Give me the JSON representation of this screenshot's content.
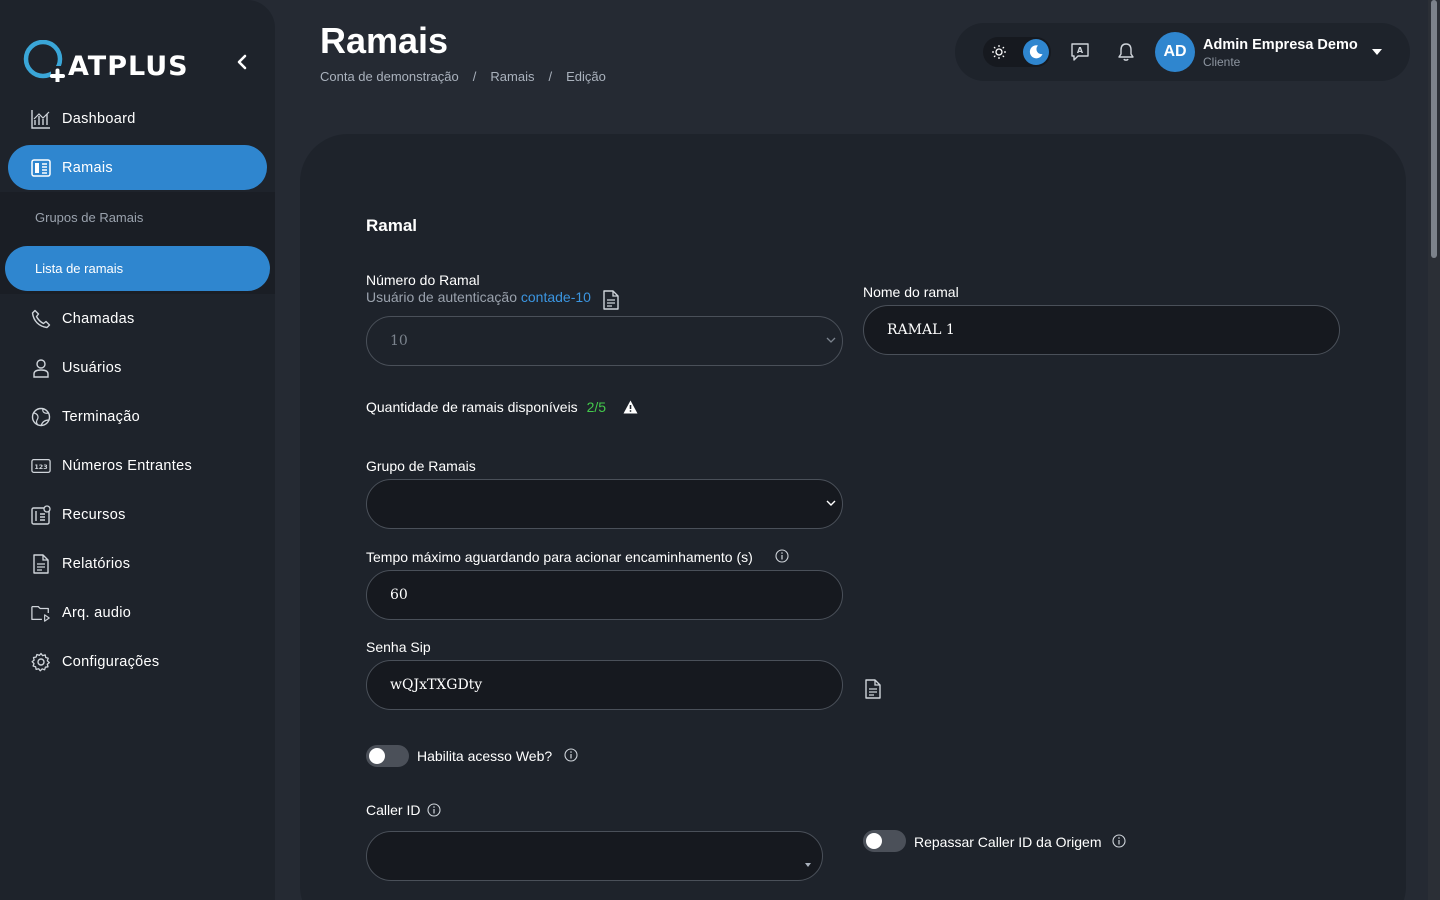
{
  "brand": {
    "logo_text": "ATPLUS"
  },
  "sidebar": {
    "items": [
      {
        "label": "Dashboard",
        "icon": "chart-icon"
      },
      {
        "label": "Ramais",
        "icon": "extension-icon",
        "active": true
      },
      {
        "label": "Chamadas",
        "icon": "phone-icon"
      },
      {
        "label": "Usuários",
        "icon": "user-icon"
      },
      {
        "label": "Terminação",
        "icon": "globe-icon"
      },
      {
        "label": "Números Entrantes",
        "icon": "numbers-icon"
      },
      {
        "label": "Recursos",
        "icon": "resources-icon"
      },
      {
        "label": "Relatórios",
        "icon": "report-icon"
      },
      {
        "label": "Arq. audio",
        "icon": "audio-folder-icon"
      },
      {
        "label": "Configurações",
        "icon": "gear-icon"
      }
    ],
    "subitems": [
      {
        "label": "Grupos de Ramais"
      },
      {
        "label": "Lista de ramais",
        "active": true
      }
    ]
  },
  "header": {
    "title": "Ramais",
    "breadcrumb": [
      "Conta de demonstração",
      "Ramais",
      "Edição"
    ],
    "user": {
      "initials": "AD",
      "name": "Admin Empresa Demo",
      "role": "Cliente"
    }
  },
  "form": {
    "section_title": "Ramal",
    "numero": {
      "label": "Número do Ramal",
      "auth_prefix": "Usuário de autenticação",
      "auth_user": "contade-10",
      "value": "10"
    },
    "nome": {
      "label": "Nome do ramal",
      "value": "RAMAL 1"
    },
    "quantidade": {
      "label": "Quantidade de ramais disponíveis",
      "value": "2/5"
    },
    "grupo": {
      "label": "Grupo de Ramais",
      "value": ""
    },
    "tempo": {
      "label": "Tempo máximo aguardando para acionar encaminhamento (s)",
      "value": "60"
    },
    "senha": {
      "label": "Senha Sip",
      "value": "wQJxTXGDty"
    },
    "web": {
      "label": "Habilita acesso Web?",
      "enabled": false
    },
    "callerid": {
      "label": "Caller ID",
      "value": ""
    },
    "repassar": {
      "label": "Repassar Caller ID da Origem",
      "enabled": false
    }
  },
  "colors": {
    "accent": "#2f86cf",
    "background": "#252a33",
    "panel": "#1e232b",
    "success": "#43c94b"
  }
}
